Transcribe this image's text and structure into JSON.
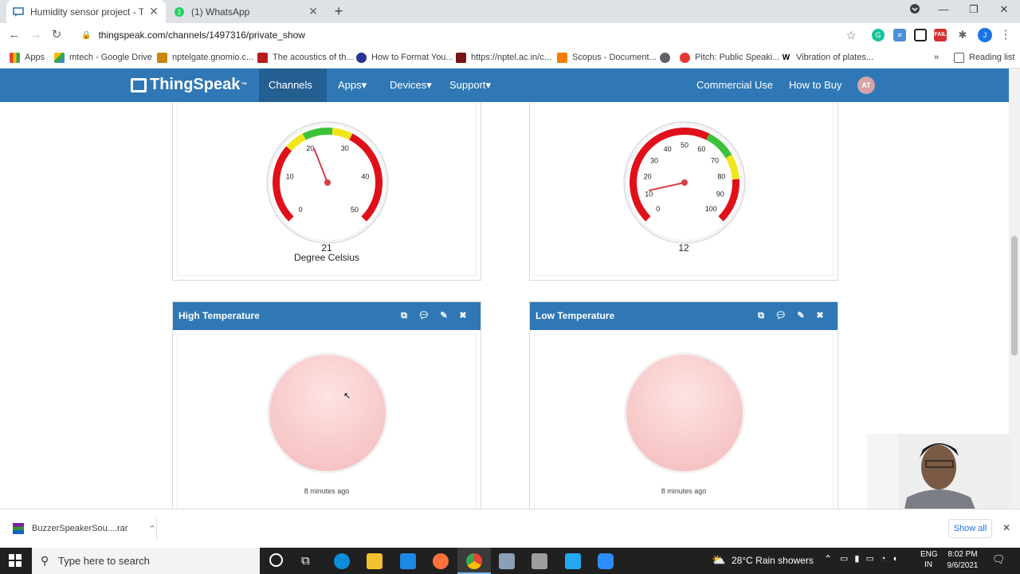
{
  "browser": {
    "tabs": [
      {
        "label": "Humidity sensor project - ThingS",
        "active": true
      },
      {
        "label": "(1) WhatsApp",
        "active": false
      }
    ],
    "url": "thingspeak.com/channels/1497316/private_show",
    "bookmarks": [
      "Apps",
      "mtech - Google Drive",
      "nptelgate.gnomio.c...",
      "The acoustics of th...",
      "How to Format You...",
      "https://nptel.ac.in/c...",
      "Scopus - Document...",
      "",
      "Pitch: Public Speaki...",
      "Vibration of plates..."
    ],
    "reading_list": "Reading list",
    "profile_initial": "J",
    "ext_fail_label": "FAIL"
  },
  "site": {
    "logo": "ThingSpeak",
    "logo_tm": "™",
    "nav": [
      "Channels",
      "Apps",
      "Devices",
      "Support"
    ],
    "nav_right": [
      "Commercial Use",
      "How to Buy"
    ],
    "avatar": "AT"
  },
  "widgets": {
    "gauge1": {
      "value": "21",
      "units": "Degree Celsius",
      "min": 0,
      "max": 50,
      "reading": 21,
      "ticks": [
        "0",
        "10",
        "20",
        "30",
        "40",
        "50"
      ]
    },
    "gauge2": {
      "value": "12",
      "units": "",
      "min": 0,
      "max": 100,
      "reading": 12,
      "ticks": [
        "0",
        "10",
        "20",
        "30",
        "40",
        "50",
        "60",
        "70",
        "80",
        "90",
        "100"
      ]
    },
    "lamp1": {
      "title": "High Temperature",
      "time": "8 minutes ago"
    },
    "lamp2": {
      "title": "Low Temperature",
      "time": "8 minutes ago"
    }
  },
  "downloads": {
    "file": "BuzzerSpeakerSou....rar",
    "show_all": "Show all"
  },
  "taskbar": {
    "search_placeholder": "Type here to search",
    "weather": "28°C  Rain showers",
    "lang1": "ENG",
    "lang2": "IN",
    "time": "8:02 PM",
    "date": "9/6/2021"
  },
  "colors": {
    "brand": "#2f78b5",
    "gauge_red": "#e0101a",
    "gauge_yellow": "#f3e51c",
    "gauge_green": "#3ec13a",
    "lamp": "#f7c9c9"
  }
}
